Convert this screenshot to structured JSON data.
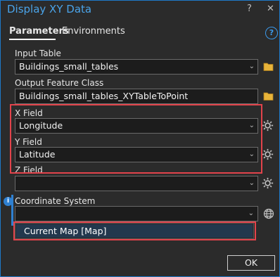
{
  "window": {
    "title": "Display XY Data",
    "help_symbol": "?",
    "close_symbol": "✕"
  },
  "tabs": [
    {
      "label": "Parameters",
      "active": true
    },
    {
      "label": "Environments",
      "active": false
    }
  ],
  "help_icon_symbol": "?",
  "params": {
    "input_table": {
      "label": "Input Table",
      "value": "Buildings_small_tables"
    },
    "output_feature_class": {
      "label": "Output Feature Class",
      "value": "Buildings_small_tables_XYTableToPoint"
    },
    "x_field": {
      "label": "X Field",
      "value": "Longitude"
    },
    "y_field": {
      "label": "Y Field",
      "value": "Latitude"
    },
    "z_field": {
      "label": "Z Field",
      "value": ""
    },
    "coordinate_system": {
      "label": "Coordinate System",
      "value": "",
      "dropdown_options": [
        "Current Map [Map]"
      ]
    }
  },
  "ok_label": "OK",
  "colors": {
    "accent": "#1e79c8",
    "highlight_box": "#e2434b",
    "folder": "#e8b43a"
  },
  "icons": [
    "folder-icon",
    "gear-icon",
    "globe-icon",
    "info-icon",
    "chevron-down-icon",
    "help-icon",
    "close-icon"
  ]
}
